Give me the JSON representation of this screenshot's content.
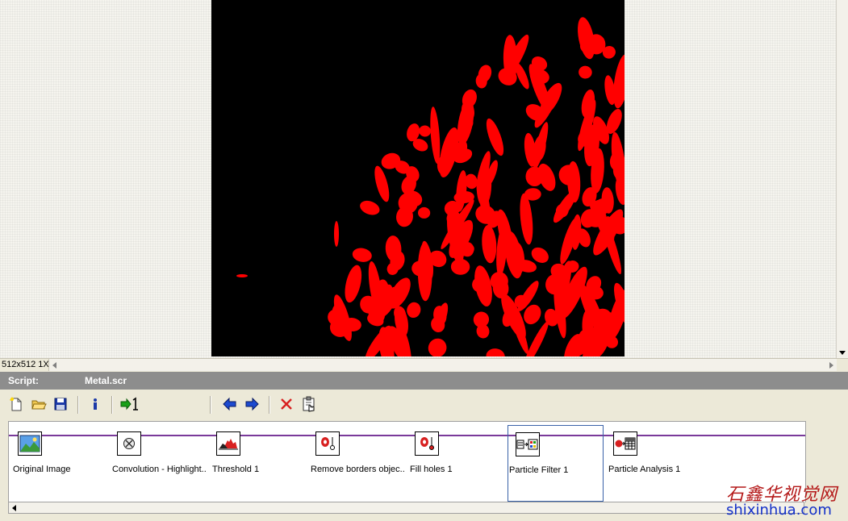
{
  "viewer": {
    "image_size": "512x512 1X"
  },
  "script": {
    "label": "Script:",
    "name": "Metal.scr"
  },
  "toolbar": {
    "buttons": [
      {
        "name": "new-script",
        "icon": "new-document-icon"
      },
      {
        "name": "open-script",
        "icon": "open-folder-icon"
      },
      {
        "name": "save-script",
        "icon": "save-disk-icon"
      },
      {
        "name": "script-info",
        "icon": "info-icon"
      },
      {
        "name": "run-once",
        "icon": "run-once-icon"
      },
      {
        "name": "move-step-left",
        "icon": "arrow-left-icon"
      },
      {
        "name": "move-step-right",
        "icon": "arrow-right-icon"
      },
      {
        "name": "delete-step",
        "icon": "delete-x-icon"
      },
      {
        "name": "step-properties",
        "icon": "clipboard-hand-icon"
      }
    ]
  },
  "pipeline": {
    "selected_step": 5,
    "steps": [
      {
        "label": "Original Image",
        "icon": "image-landscape-icon"
      },
      {
        "label": "Convolution - Highlight..",
        "icon": "convolution-icon"
      },
      {
        "label": "Threshold 1",
        "icon": "threshold-histogram-icon"
      },
      {
        "label": "Remove borders objec..",
        "icon": "remove-border-objects-icon"
      },
      {
        "label": "Fill holes 1",
        "icon": "fill-holes-icon"
      },
      {
        "label": "Particle Filter 1",
        "icon": "particle-filter-icon"
      },
      {
        "label": "Particle Analysis 1",
        "icon": "particle-analysis-icon"
      }
    ]
  },
  "watermark": {
    "chinese": "石鑫华视觉网",
    "url": "shixinhua.com"
  },
  "colors": {
    "particle": "#ff0000",
    "background": "#000000",
    "pipeline_line": "#7a3a9a",
    "script_bar": "#8d8d8d"
  }
}
